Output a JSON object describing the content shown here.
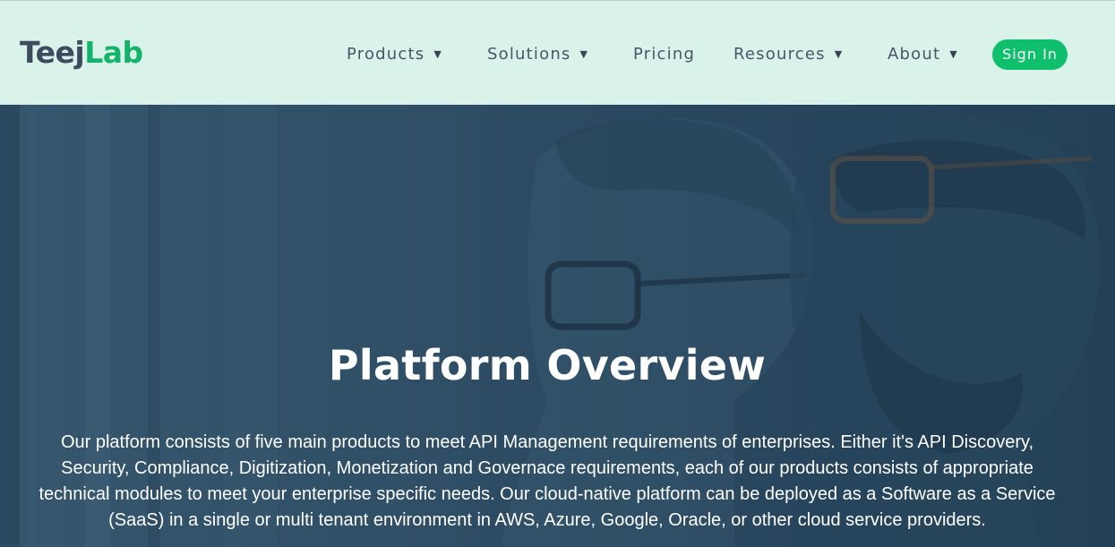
{
  "brand": {
    "logo_part1": "Teej",
    "logo_part2": "Lab"
  },
  "nav": {
    "items": [
      {
        "label": "Products",
        "has_dropdown": true
      },
      {
        "label": "Solutions",
        "has_dropdown": true
      },
      {
        "label": "Pricing",
        "has_dropdown": false
      },
      {
        "label": "Resources",
        "has_dropdown": true
      },
      {
        "label": "About",
        "has_dropdown": true
      }
    ],
    "caret": "▼",
    "signin_label": "Sign In"
  },
  "hero": {
    "title": "Platform Overview",
    "body": "Our platform consists of five main products to meet API Management requirements of enterprises. Either it's API Discovery, Security, Compliance, Digitization, Monetization and Governace requirements, each of our products consists of appropriate technical modules to meet your enterprise specific needs. Our cloud-native platform can be deployed as a Software as a Service (SaaS) in a single or multi tenant environment in AWS, Azure, Google, Oracle, or other cloud service providers."
  },
  "colors": {
    "nav_bg": "#d9f2ea",
    "brand_dark": "#3f4a5f",
    "brand_green": "#15b36a",
    "signin_bg": "#0fbf6c",
    "hero_overlay": "#2f5068"
  }
}
